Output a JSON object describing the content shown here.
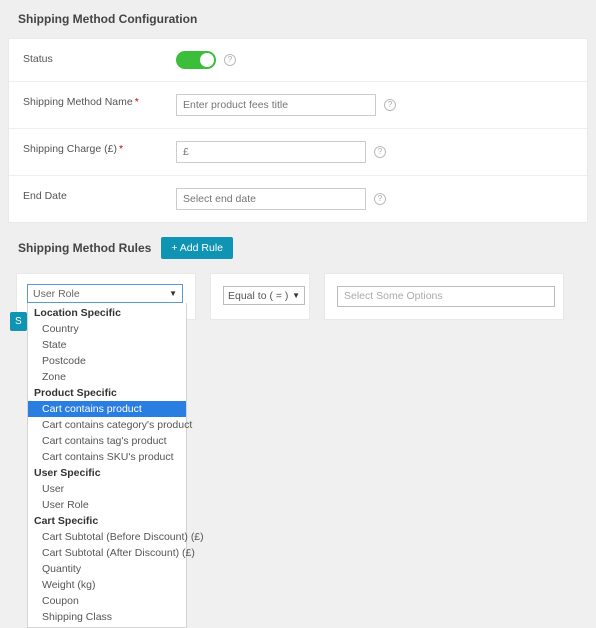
{
  "section_config_title": "Shipping Method Configuration",
  "labels": {
    "status": "Status",
    "method_name": "Shipping Method Name",
    "charge": "Shipping Charge (£)",
    "end_date": "End Date"
  },
  "placeholders": {
    "method_name": "Enter product fees title",
    "charge": "£",
    "end_date": "Select end date"
  },
  "status_on": true,
  "rules_title": "Shipping Method Rules",
  "add_rule_label": "+ Add Rule",
  "rule_row": {
    "attribute_selected": "User Role",
    "condition_selected": "Equal to ( = )",
    "values_placeholder": "Select Some Options"
  },
  "dropdown": {
    "groups": [
      {
        "label": "Location Specific",
        "items": [
          {
            "label": "Country"
          },
          {
            "label": "State"
          },
          {
            "label": "Postcode"
          },
          {
            "label": "Zone"
          }
        ]
      },
      {
        "label": "Product Specific",
        "items": [
          {
            "label": "Cart contains product",
            "highlight": true
          },
          {
            "label": "Cart contains category's product"
          },
          {
            "label": "Cart contains tag's product"
          },
          {
            "label": "Cart contains SKU's product"
          }
        ]
      },
      {
        "label": "User Specific",
        "items": [
          {
            "label": "User"
          },
          {
            "label": "User Role"
          }
        ]
      },
      {
        "label": "Cart Specific",
        "items": [
          {
            "label": "Cart Subtotal (Before Discount) (£)"
          },
          {
            "label": "Cart Subtotal (After Discount) (£)"
          },
          {
            "label": "Quantity"
          },
          {
            "label": "Weight (kg)"
          },
          {
            "label": "Coupon"
          },
          {
            "label": "Shipping Class"
          }
        ]
      }
    ]
  },
  "save_fragment": "S"
}
